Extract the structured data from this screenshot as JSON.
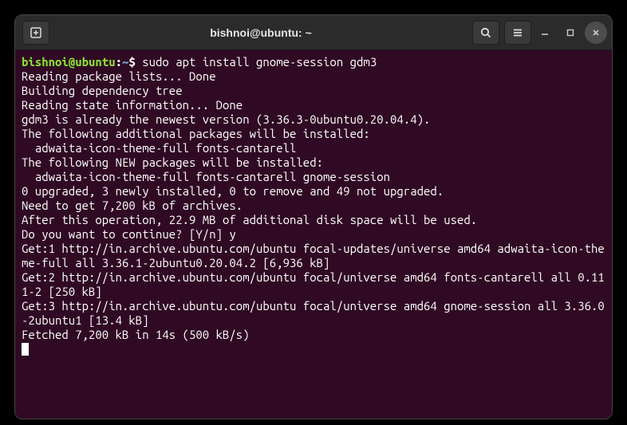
{
  "titlebar": {
    "title": "bishnoi@ubuntu: ~"
  },
  "prompt": {
    "user_host": "bishnoi@ubuntu",
    "colon": ":",
    "path": "~",
    "dollar": "$"
  },
  "command": " sudo apt install gnome-session gdm3",
  "output": {
    "l1": "Reading package lists... Done",
    "l2": "Building dependency tree",
    "l3": "Reading state information... Done",
    "l4": "gdm3 is already the newest version (3.36.3-0ubuntu0.20.04.4).",
    "l5": "The following additional packages will be installed:",
    "l6": "  adwaita-icon-theme-full fonts-cantarell",
    "l7": "The following NEW packages will be installed:",
    "l8": "  adwaita-icon-theme-full fonts-cantarell gnome-session",
    "l9": "0 upgraded, 3 newly installed, 0 to remove and 49 not upgraded.",
    "l10": "Need to get 7,200 kB of archives.",
    "l11": "After this operation, 22.9 MB of additional disk space will be used.",
    "l12": "Do you want to continue? [Y/n] y",
    "l13": "Get:1 http://in.archive.ubuntu.com/ubuntu focal-updates/universe amd64 adwaita-icon-theme-full all 3.36.1-2ubuntu0.20.04.2 [6,936 kB]",
    "l14": "Get:2 http://in.archive.ubuntu.com/ubuntu focal/universe amd64 fonts-cantarell all 0.111-2 [250 kB]",
    "l15": "Get:3 http://in.archive.ubuntu.com/ubuntu focal/universe amd64 gnome-session all 3.36.0-2ubuntu1 [13.4 kB]",
    "l16": "Fetched 7,200 kB in 14s (500 kB/s)"
  }
}
